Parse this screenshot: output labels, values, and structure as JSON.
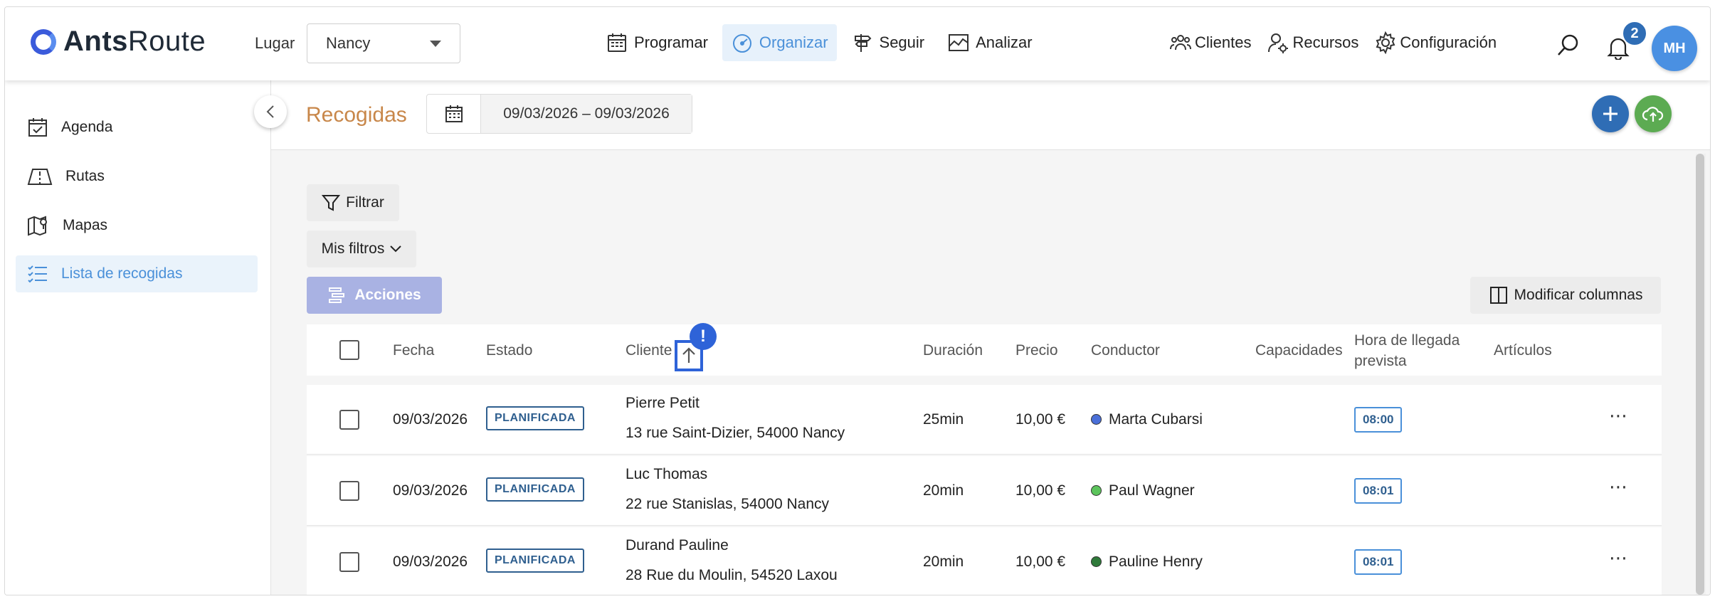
{
  "brand": {
    "name_bold": "Ants",
    "name_rest": "Route"
  },
  "location": {
    "label": "Lugar",
    "value": "Nancy"
  },
  "main_nav": [
    {
      "label": "Programar",
      "icon": "calendar-grid-icon"
    },
    {
      "label": "Organizar",
      "icon": "speedometer-icon",
      "active": true
    },
    {
      "label": "Seguir",
      "icon": "signpost-icon"
    },
    {
      "label": "Analizar",
      "icon": "chart-area-icon"
    }
  ],
  "right_nav": [
    {
      "label": "Clientes",
      "icon": "users-group-icon"
    },
    {
      "label": "Recursos",
      "icon": "user-gear-icon"
    },
    {
      "label": "Configuración",
      "icon": "gear-icon"
    }
  ],
  "notifications": {
    "count": "2"
  },
  "user": {
    "initials": "MH"
  },
  "sidebar": {
    "items": [
      {
        "label": "Agenda",
        "icon": "calendar-check-icon"
      },
      {
        "label": "Rutas",
        "icon": "route-map-icon"
      },
      {
        "label": "Mapas",
        "icon": "map-pin-icon"
      },
      {
        "label": "Lista de recogidas",
        "icon": "checklist-icon",
        "active": true
      }
    ]
  },
  "page": {
    "title": "Recogidas",
    "date_range": "09/03/2026 – 09/03/2026"
  },
  "toolbar": {
    "filter_label": "Filtrar",
    "my_filters_label": "Mis filtros",
    "actions_label": "Acciones",
    "modify_columns_label": "Modificar columnas"
  },
  "table": {
    "columns": {
      "fecha": "Fecha",
      "estado": "Estado",
      "cliente": "Cliente",
      "duracion": "Duración",
      "precio": "Precio",
      "conductor": "Conductor",
      "capacidades": "Capacidades",
      "hora_line1": "Hora de llegada",
      "hora_line2": "prevista",
      "articulos": "Artículos"
    },
    "rows": [
      {
        "fecha": "09/03/2026",
        "estado": "PLANIFICADA",
        "cliente": "Pierre Petit",
        "direccion": "13 rue Saint-Dizier, 54000 Nancy",
        "duracion": "25min",
        "precio": "10,00 €",
        "conductor": "Marta Cubarsi",
        "conductor_color": "#4a6fd8",
        "hora": "08:00"
      },
      {
        "fecha": "09/03/2026",
        "estado": "PLANIFICADA",
        "cliente": "Luc Thomas",
        "direccion": "22 rue Stanislas, 54000 Nancy",
        "duracion": "20min",
        "precio": "10,00 €",
        "conductor": "Paul Wagner",
        "conductor_color": "#5cc45c",
        "hora": "08:01"
      },
      {
        "fecha": "09/03/2026",
        "estado": "PLANIFICADA",
        "cliente": "Durand Pauline",
        "direccion": "28 Rue du Moulin, 54520 Laxou",
        "duracion": "20min",
        "precio": "10,00 €",
        "conductor": "Pauline Henry",
        "conductor_color": "#2f7a3a",
        "hora": "08:01"
      }
    ]
  },
  "sort_indicator": {
    "icon": "arrow-up-icon",
    "alert_mark": "!"
  },
  "colors": {
    "accent": "#4a90d9",
    "primary": "#2f6db5",
    "title": "#c8874a",
    "upload": "#5cab52"
  }
}
